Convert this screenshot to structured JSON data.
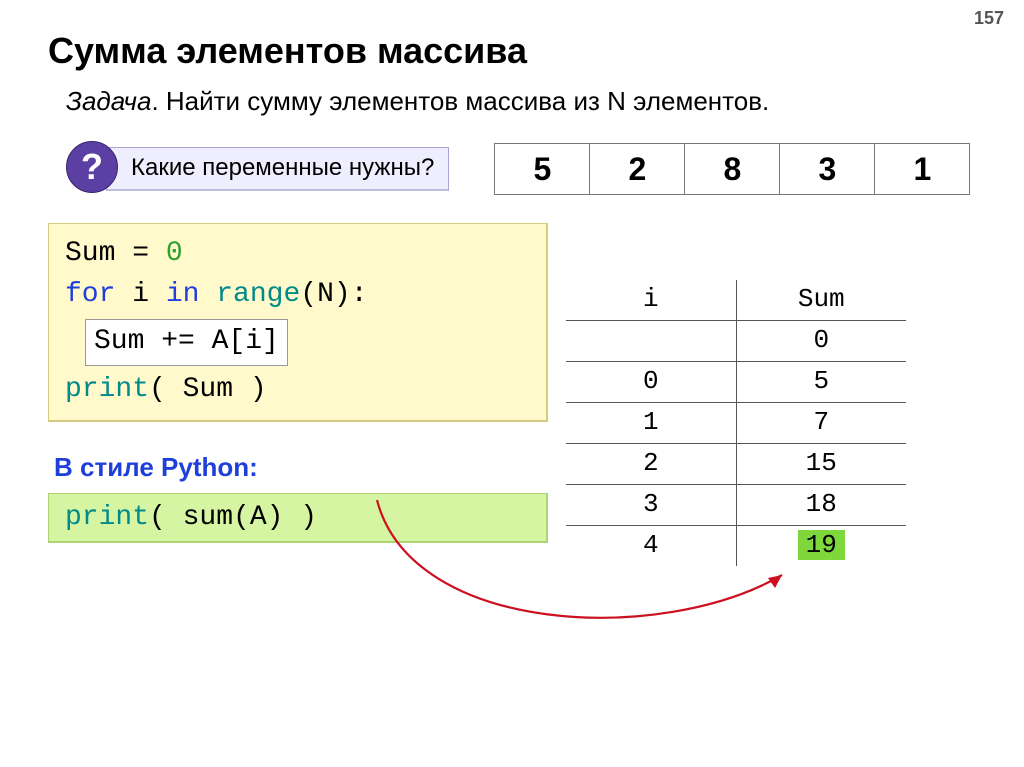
{
  "page_number": "157",
  "title": "Сумма элементов массива",
  "task_label": "Задача",
  "task_text": ". Найти сумму элементов массива из N элементов.",
  "q_mark": "?",
  "question": "Какие переменные нужны?",
  "array": [
    "5",
    "2",
    "8",
    "3",
    "1"
  ],
  "code": {
    "l1a": "Sum = ",
    "l1b": "0",
    "l2a": "for",
    "l2b": " i ",
    "l2c": "in",
    "l2d": " range",
    "l2e": "(N):",
    "l3": "Sum += A[i]",
    "l4a": "print",
    "l4b": "( Sum )"
  },
  "trace": {
    "col_i": "i",
    "col_sum": "Sum",
    "rows": [
      {
        "i": "",
        "s": "0"
      },
      {
        "i": "0",
        "s": "5"
      },
      {
        "i": "1",
        "s": "7"
      },
      {
        "i": "2",
        "s": "15"
      },
      {
        "i": "3",
        "s": "18"
      },
      {
        "i": "4",
        "s": "19"
      }
    ]
  },
  "python_style_label": "В стиле Python:",
  "python_code_a": "print",
  "python_code_b": "( sum(A) )"
}
